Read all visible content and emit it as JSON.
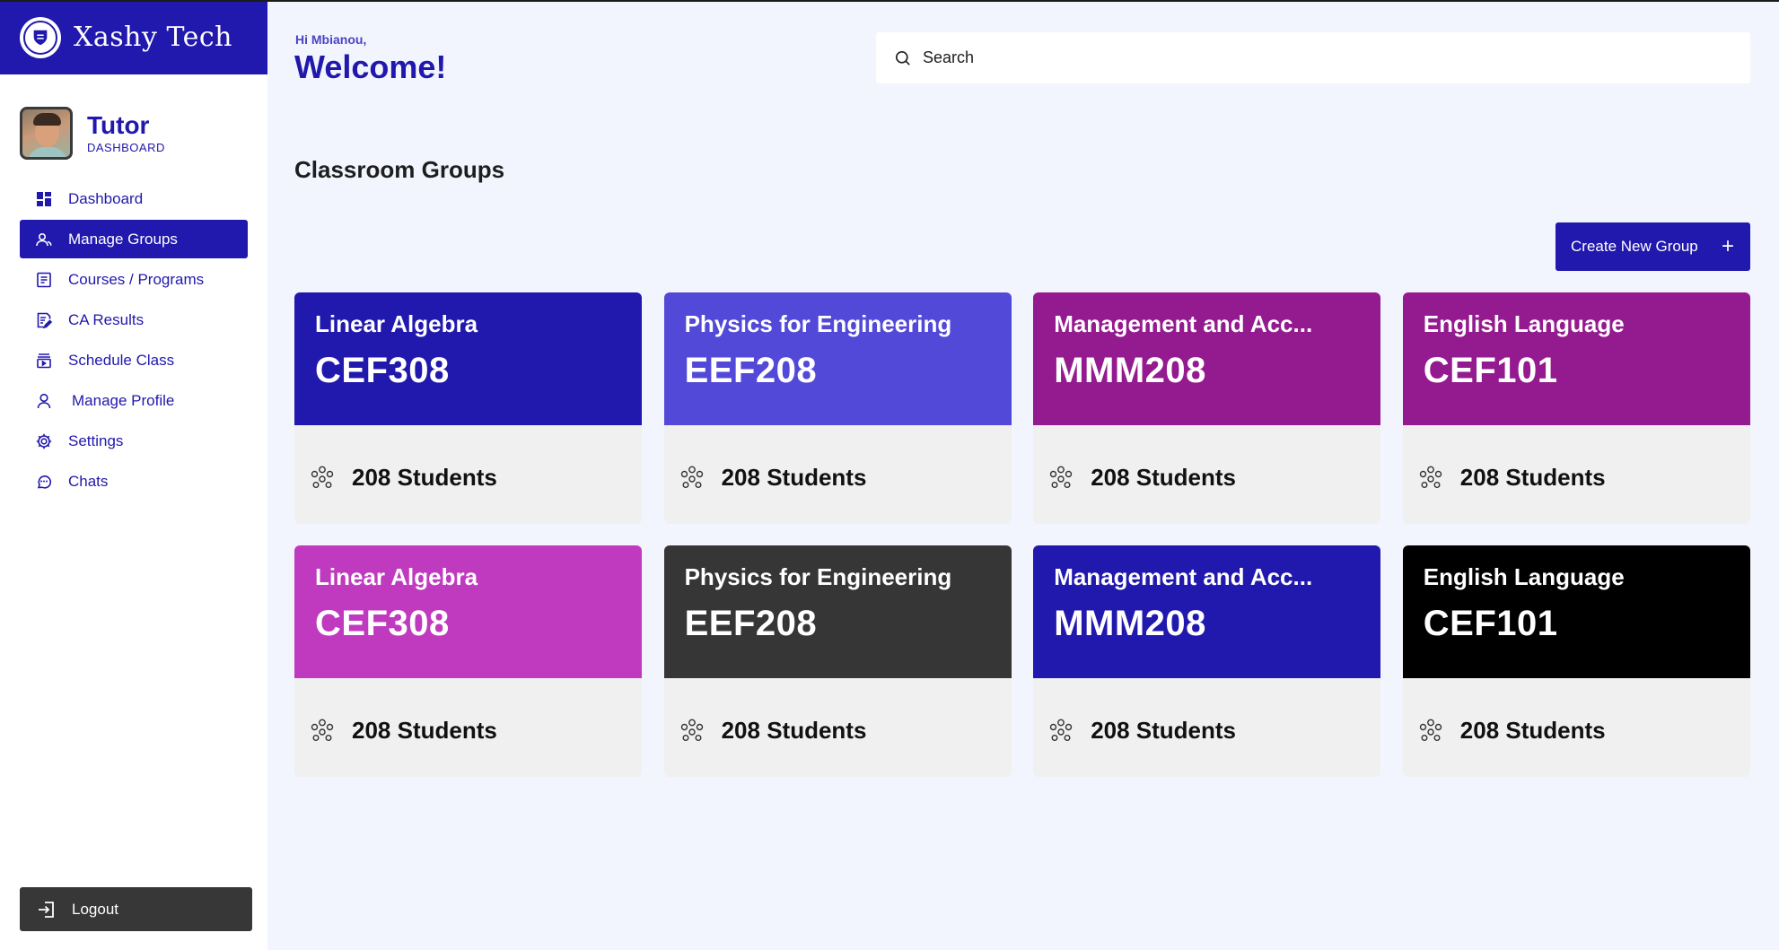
{
  "brand": {
    "name": "Xashy Tech"
  },
  "profile": {
    "role": "Tutor",
    "subtitle": "DASHBOARD"
  },
  "nav": [
    {
      "label": "Dashboard",
      "icon": "grid-icon",
      "active": false
    },
    {
      "label": "Manage Groups",
      "icon": "users-icon",
      "active": true
    },
    {
      "label": "Courses / Programs",
      "icon": "document-icon",
      "active": false
    },
    {
      "label": "CA Results",
      "icon": "edit-document-icon",
      "active": false
    },
    {
      "label": "Schedule Class",
      "icon": "calendar-icon",
      "active": false
    },
    {
      "label": "Manage Profile",
      "icon": "user-icon",
      "active": false
    },
    {
      "label": "Settings",
      "icon": "gear-icon",
      "active": false
    },
    {
      "label": "Chats",
      "icon": "chat-icon",
      "active": false
    }
  ],
  "logout": {
    "label": "Logout"
  },
  "header": {
    "greeting": "Hi Mbianou,",
    "welcome": "Welcome!"
  },
  "search": {
    "placeholder": "Search"
  },
  "section": {
    "title": "Classroom Groups"
  },
  "create_button": {
    "label": "Create New Group",
    "icon": "plus-icon"
  },
  "groups": [
    {
      "name": "Linear Algebra",
      "code": "CEF308",
      "students": "208 Students",
      "color": "#2118ad"
    },
    {
      "name": "Physics for Engineering",
      "code": "EEF208",
      "students": "208 Students",
      "color": "#5349d8"
    },
    {
      "name": "Management and Acc...",
      "code": "MMM208",
      "students": "208 Students",
      "color": "#941a90"
    },
    {
      "name": "English Language",
      "code": "CEF101",
      "students": "208 Students",
      "color": "#941a90"
    },
    {
      "name": "Linear Algebra",
      "code": "CEF308",
      "students": "208 Students",
      "color": "#c03abf"
    },
    {
      "name": "Physics for Engineering",
      "code": "EEF208",
      "students": "208 Students",
      "color": "#363636"
    },
    {
      "name": "Management and Acc...",
      "code": "MMM208",
      "students": "208 Students",
      "color": "#2118ad"
    },
    {
      "name": "English Language",
      "code": "CEF101",
      "students": "208 Students",
      "color": "#000000"
    }
  ]
}
